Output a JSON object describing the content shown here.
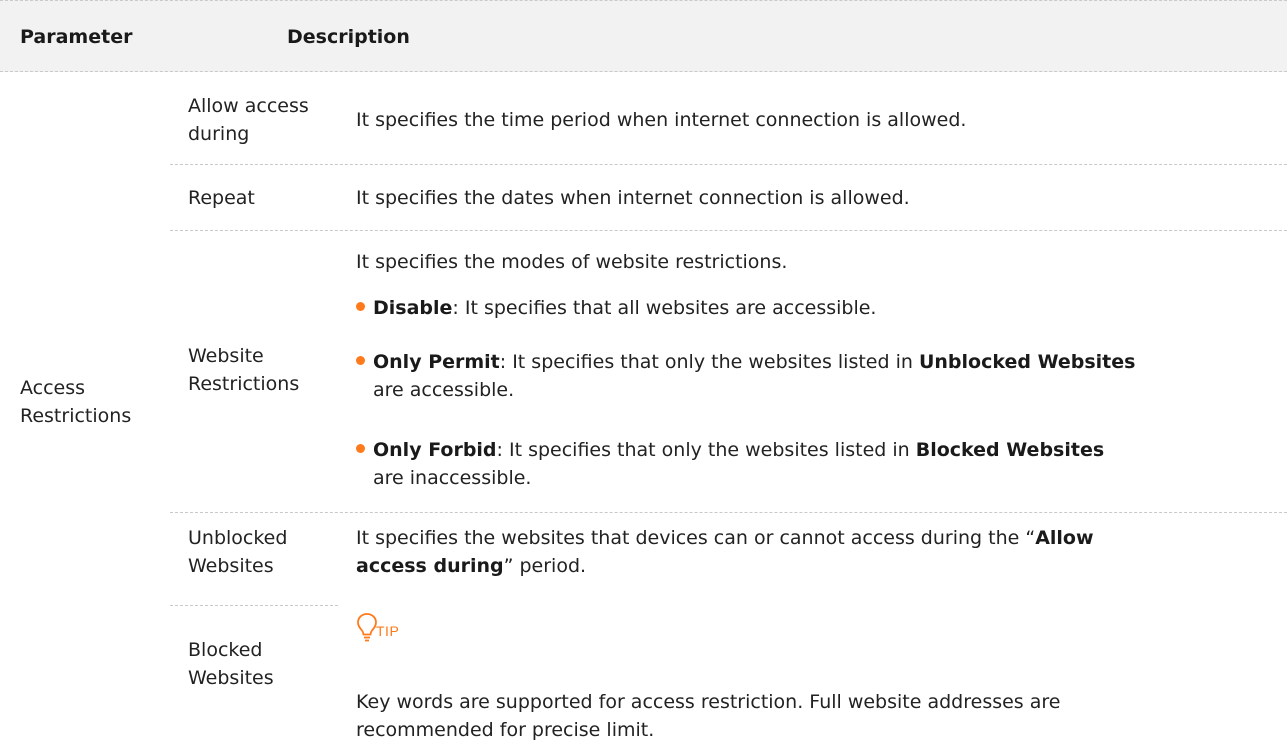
{
  "header": {
    "parameter": "Parameter",
    "description": "Description"
  },
  "group": {
    "label_line1": "Access",
    "label_line2": "Restrictions"
  },
  "rows": {
    "allow_access": {
      "param_line1": "Allow access",
      "param_line2": "during",
      "description": "It specifies the time period when internet connection is allowed."
    },
    "repeat": {
      "param": "Repeat",
      "description": "It specifies the dates when internet connection is allowed."
    },
    "website_restrictions": {
      "param_line1": "Website",
      "param_line2": "Restrictions",
      "intro": "It specifies the modes of website restrictions.",
      "bullets": [
        {
          "term": "Disable",
          "text": ": It specifies that all websites are accessible."
        },
        {
          "term": "Only Permit",
          "text": ": It specifies that only the websites listed in ",
          "ref": "Unblocked Websites",
          "tail": "are accessible."
        },
        {
          "term": "Only Forbid",
          "text": ": It specifies that only the websites listed in ",
          "ref": "Blocked Websites",
          "tail": "are inaccessible."
        }
      ]
    },
    "unblocked": {
      "param_line1": "Unblocked",
      "param_line2": "Websites"
    },
    "blocked": {
      "param_line1": "Blocked",
      "param_line2": "Websites"
    },
    "websites_desc": {
      "line1_pre": "It specifies the websites that devices can or cannot access during the “",
      "line1_bold": "Allow",
      "line2_bold": "access during",
      "line2_post": "” period."
    }
  },
  "tip": {
    "label": "TIP",
    "icon": "lightbulb-icon",
    "text_line1": "Key words are supported for access restriction. Full website addresses are",
    "text_line2": "recommended for precise limit."
  },
  "colors": {
    "accent": "#ff7a1a",
    "header_bg": "#f2f2f2",
    "divider": "#c9c9c9"
  }
}
